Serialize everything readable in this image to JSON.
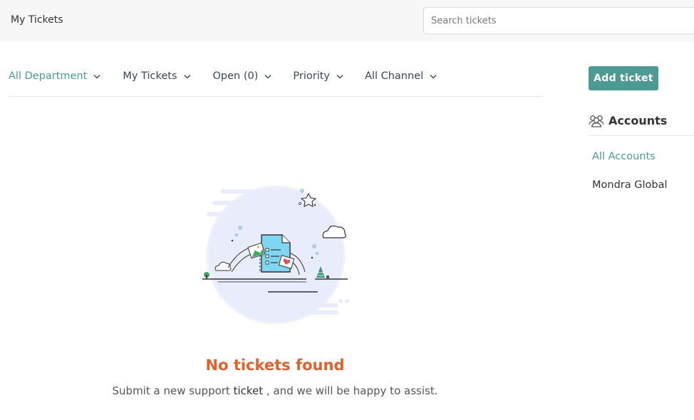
{
  "header": {
    "title": "My Tickets",
    "search_placeholder": "Search tickets"
  },
  "filters": [
    {
      "label": "All Department",
      "active": true
    },
    {
      "label": "My Tickets",
      "active": false
    },
    {
      "label": "Open (0)",
      "active": false
    },
    {
      "label": "Priority",
      "active": false
    },
    {
      "label": "All Channel",
      "active": false
    }
  ],
  "sidebar": {
    "add_ticket_label": "Add ticket",
    "accounts_title": "Accounts",
    "accounts": [
      {
        "label": "All Accounts",
        "active": true
      },
      {
        "label": "Mondra Global",
        "active": false
      }
    ]
  },
  "empty_state": {
    "title": "No tickets found",
    "text_before": "Submit a new support",
    "text_em": "ticket",
    "text_after": ", and we will be happy to assist."
  },
  "colors": {
    "accent": "#4d9a94",
    "empty_title": "#e0612c"
  }
}
